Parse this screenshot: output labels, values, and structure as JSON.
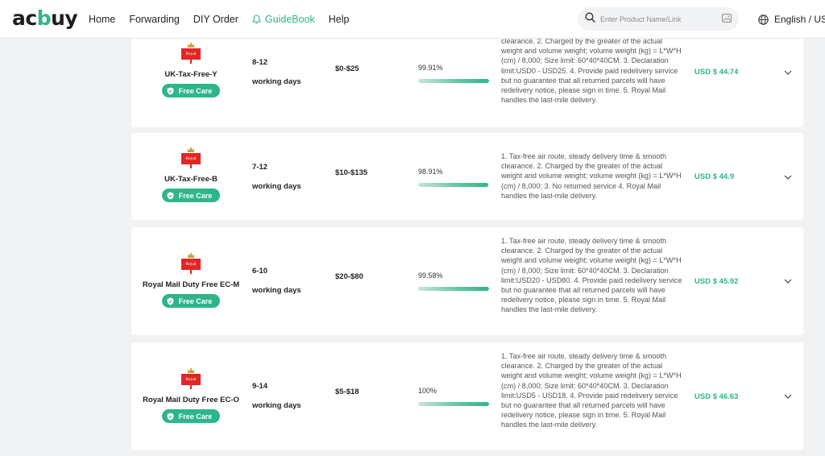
{
  "header": {
    "logo": {
      "text_left": "ac",
      "text_mark": "b",
      "text_right": "uy"
    },
    "nav": [
      "Home",
      "Forwarding",
      "DIY Order",
      "GuideBook",
      "Help"
    ],
    "active_nav": "GuideBook",
    "search_placeholder": "Enter Product Name/Link",
    "language": "English / USI"
  },
  "colors": {
    "accent": "#2fb58b",
    "royal_mail_red": "#e42525"
  },
  "free_care_label": "Free Care",
  "carrier_logo_text": "Royal Mail",
  "routes": [
    {
      "name": "UK-Tax-Free-Y",
      "days": "8-12",
      "days_unit": "working days",
      "range": "$0-$25",
      "success_rate": "99.91%",
      "rate_fraction": 0.9991,
      "description": "clearance. 2. Charged by the greater of the actual weight and volume weight; volume weight (kg) = L*W*H (cm) / 8,000; Size limit: 60*40*40CM. 3. Declaration limit:USD0 - USD25. 4. Provide paid redelivery service but no guarantee that all returned parcels will have redelivery notice, please sign in time. 5. Royal Mail handles the last-mile delivery.",
      "price": "USD $ 44.74"
    },
    {
      "name": "UK-Tax-Free-B",
      "days": "7-12",
      "days_unit": "working days",
      "range": "$10-$135",
      "success_rate": "98.91%",
      "rate_fraction": 0.9891,
      "description": "1. Tax-free air route, steady delivery time & smooth clearance. 2. Charged by the greater of the actual weight and volume weight; volume weight (kg) = L*W*H (cm) / 8,000; 3. No returned service 4. Royal Mail handles the last-mile delivery.",
      "price": "USD $ 44.9"
    },
    {
      "name": "Royal Mail Duty Free EC-M",
      "days": "6-10",
      "days_unit": "working days",
      "range": "$20-$80",
      "success_rate": "99.58%",
      "rate_fraction": 0.9958,
      "description": "1. Tax-free air route, steady delivery time & smooth clearance. 2. Charged by the greater of the actual weight and volume weight; volume weight (kg) = L*W*H (cm) / 8,000; Size limit: 60*40*40CM. 3. Declaration limit:USD20 - USD80. 4. Provide paid redelivery service but no guarantee that all returned parcels will have redelivery notice, please sign in time. 5. Royal Mail handles the last-mile delivery.",
      "price": "USD $ 45.92"
    },
    {
      "name": "Royal Mail Duty Free EC-O",
      "days": "9-14",
      "days_unit": "working days",
      "range": "$5-$18",
      "success_rate": "100%",
      "rate_fraction": 1.0,
      "description": "1. Tax-free air route, steady delivery time & smooth clearance. 2. Charged by the greater of the actual weight and volume weight; volume weight (kg) = L*W*H (cm) / 8,000; Size limit: 60*40*40CM. 3. Declaration limit:USD5 - USD18. 4. Provide paid redelivery service but no guarantee that all returned parcels will have redelivery notice, please sign in time. 5. Royal Mail handles the last-mile delivery.",
      "price": "USD $ 46.63"
    }
  ]
}
